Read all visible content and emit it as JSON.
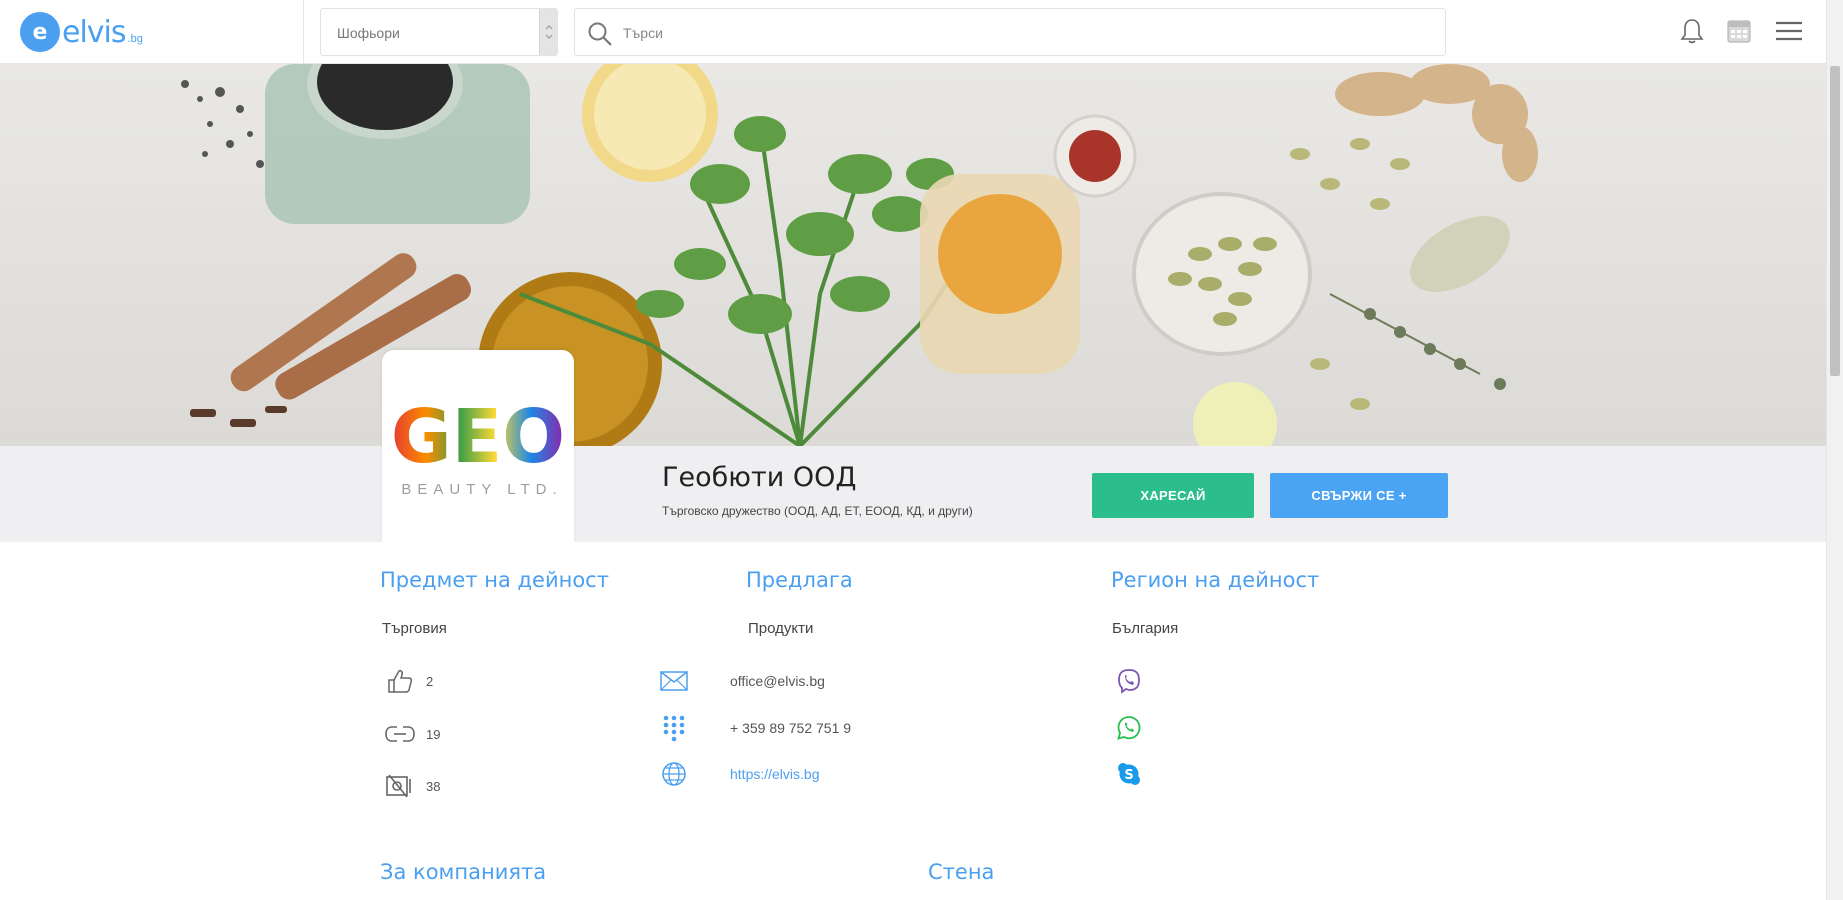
{
  "header": {
    "logo_mark": "e",
    "logo_text": "elvis",
    "logo_suffix": ".bg",
    "filter_value": "Шофьори",
    "search_placeholder": "Търси"
  },
  "icons": {
    "search": "search-icon",
    "notifications": "bell-icon",
    "calendar": "calendar-icon",
    "menu": "hamburger-menu-icon"
  },
  "company": {
    "logo_text": "GEO",
    "logo_subtext": "BEAUTY LTD.",
    "name": "Геобюти ООД",
    "type": "Търговско дружество (ООД, АД, ЕТ, ЕООД, КД, и други)",
    "like_label": "ХАРЕСАЙ",
    "contact_label": "СВЪРЖИ СЕ +"
  },
  "info": {
    "activity_heading": "Предмет на дейност",
    "activity_value": "Търговия",
    "offers_heading": "Предлага",
    "offers_value": "Продукти",
    "region_heading": "Регион на дейност",
    "region_value": "България"
  },
  "stats": {
    "likes": "2",
    "links": "19",
    "views": "38"
  },
  "contacts": {
    "email": "office@elvis.bg",
    "phone": "+ 359 89 752 751 9",
    "website": "https://elvis.bg"
  },
  "bottom": {
    "about_heading": "За компанията",
    "wall_heading": "Стена"
  },
  "colors": {
    "accent": "#4a9ff0",
    "like_button": "#2cbd8c",
    "contact_button": "#4aa3f3",
    "viber": "#7d56b4",
    "whatsapp": "#25c04d",
    "skype": "#1a9bea"
  }
}
